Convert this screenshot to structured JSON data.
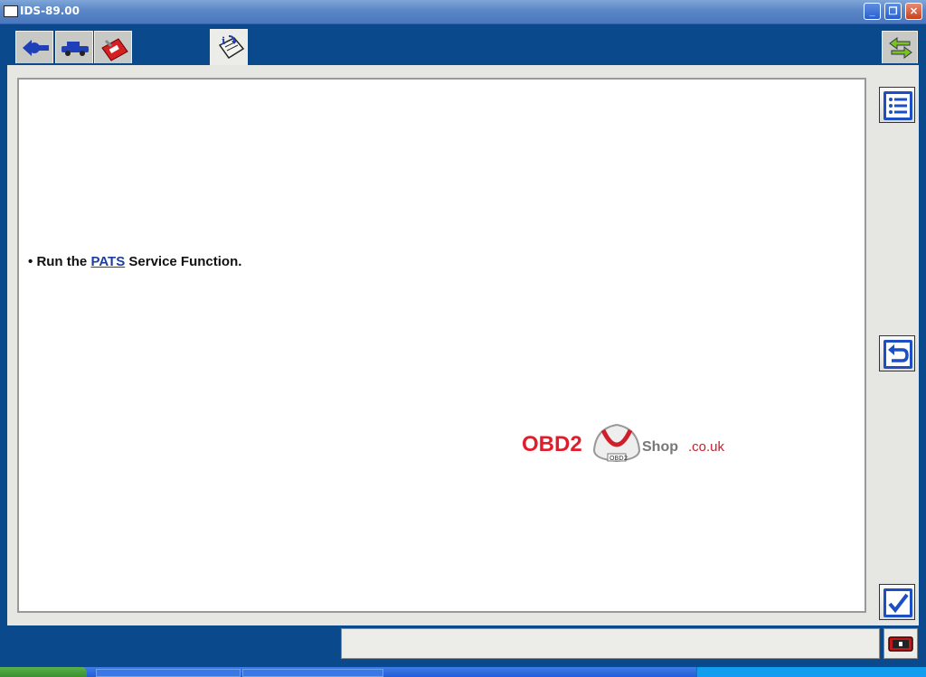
{
  "window": {
    "title": "IDS-89.00"
  },
  "toolbar": {
    "tabs": [
      {
        "icon": "back-arrow-icon"
      },
      {
        "icon": "vehicle-icon"
      },
      {
        "icon": "toolbox-icon"
      },
      {
        "icon": "info-document-icon",
        "active": true
      }
    ],
    "right_icon": "swap-arrows-icon"
  },
  "content": {
    "bullet": "•",
    "prefix": "Run the",
    "link": "PATS",
    "suffix": "Service Function."
  },
  "watermark": {
    "brand": "OBD2",
    "shop": "Shop",
    "domain": ".co.uk",
    "badge": "OBD2"
  },
  "side_buttons": [
    {
      "icon": "list-icon"
    },
    {
      "icon": "return-icon"
    },
    {
      "icon": "checkmark-icon"
    }
  ],
  "colors": {
    "frame_blue": "#0a4a8c",
    "link": "#1b3fa0",
    "brand_red": "#e21d2b"
  }
}
